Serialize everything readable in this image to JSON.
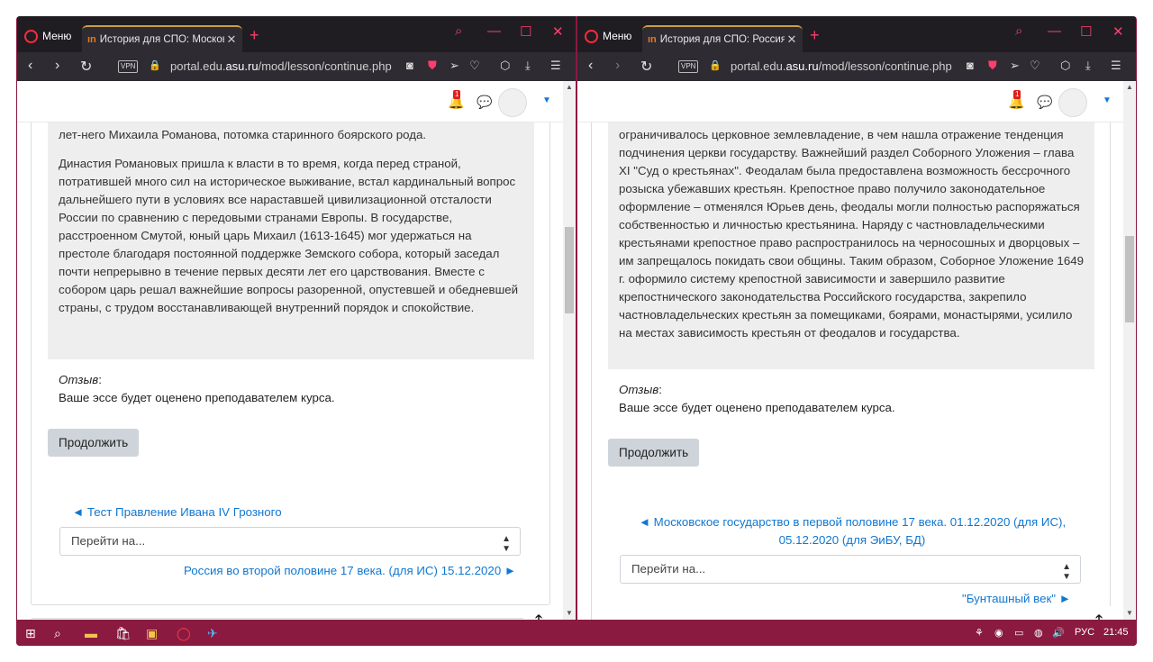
{
  "left_window": {
    "menu_label": "Меню",
    "tab_title": "История для СПО: Москов",
    "url_prefix": "portal.edu.",
    "url_domain": "asu.ru",
    "url_path": "/mod/lesson/continue.php",
    "notif_count": "1",
    "essay_lines_top": "лет-него Михаила Романова, потомка старинного боярского рода.",
    "essay_p2": "Династия Романовых пришла к власти в то время, когда перед страной, потратившей много сил на историческое выживание, встал кардинальный вопрос дальнейшего пути в условиях все нараставшей цивилизационной отсталости России по сравнению с передовыми странами Европы. В государстве, расстроенном Смутой, юный царь Михаил (1613-1645) мог удержаться на престоле благодаря постоянной поддержке Земского собора, который заседал почти непрерывно в течение первых десяти лет его царствования. Вместе с собором царь решал важнейшие вопросы разоренной, опустевшей и обедневшей страны, с трудом восстанавливающей внутренний порядок и спокойствие.",
    "feedback_label": "Отзыв",
    "feedback_text": "Ваше эссе будет оценено преподавателем курса.",
    "continue_btn": "Продолжить",
    "prev_link": "◄ Тест Правление Ивана IV Грозного",
    "jump_placeholder": "Перейти на...",
    "next_link": "Россия во второй половине 17 века. (для ИС) 15.12.2020 ►"
  },
  "right_window": {
    "menu_label": "Меню",
    "tab_title": "История для СПО: Россия",
    "url_prefix": "portal.edu.",
    "url_domain": "asu.ru",
    "url_path": "/mod/lesson/continue.php",
    "notif_count": "1",
    "essay_text": "ограничивалось церковное землевладение, в чем нашла отражение тенденция подчинения церкви государству. Важнейший раздел Соборного Уложения – глава XI \"Суд о крестьянах\". Феодалам была предоставлена возможность бессрочного розыска убежавших крестьян. Крепостное право получило законодательное оформление – отменялся Юрьев день, феодалы могли полностью распоряжаться собственностью и личностью крестьянина. Наряду с частновладельческими крестьянами крепостное право распространилось на черносошных и дворцовых – им запрещалось покидать свои общины. Таким образом, Соборное Уложение 1649 г. оформило систему крепостной зависимости и завершило развитие крепостнического законодательства Российского государства, закрепило частновладельческих крестьян за помещиками, боярами, монастырями, усилило на местах зависимость крестьян от феодалов и государства.",
    "feedback_label": "Отзыв",
    "feedback_text": "Ваше эссе будет оценено преподавателем курса.",
    "continue_btn": "Продолжить",
    "prev_link_1": "◄ Московское государство в первой половине 17 века. 01.12.2020 (для ИС),",
    "prev_link_2": "05.12.2020 (для ЭиБУ, БД)",
    "jump_placeholder": "Перейти на...",
    "next_link": "\"Бунташный век\" ►"
  },
  "taskbar": {
    "language": "РУС",
    "time": "21:45"
  },
  "colors": {
    "accent": "#8a1a40",
    "link": "#1177d1",
    "essay_bg": "#eeeeee",
    "browser_dark": "#1f1d22"
  }
}
